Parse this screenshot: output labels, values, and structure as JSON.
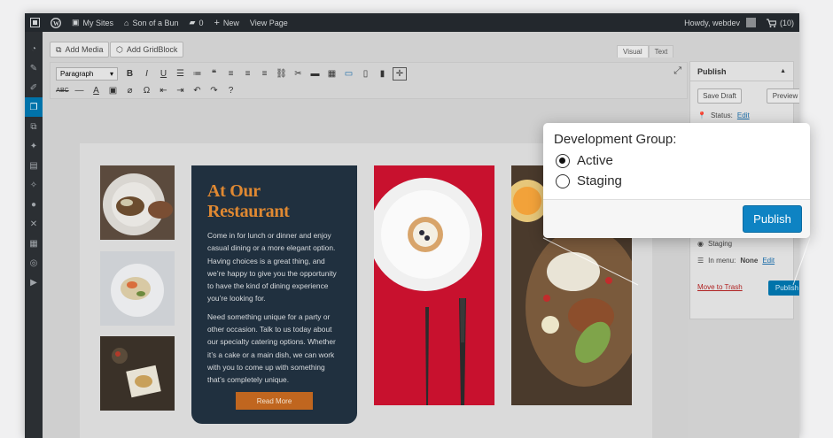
{
  "adminbar": {
    "my_sites": "My Sites",
    "site_name": "Son of a Bun",
    "comments_count": "0",
    "new_label": "New",
    "view_page": "View Page",
    "howdy": "Howdy, webdev",
    "cart": "(10)"
  },
  "editor": {
    "add_media": "Add Media",
    "add_gridblock": "Add GridBlock",
    "tab_visual": "Visual",
    "tab_text": "Text",
    "format_select": "Paragraph"
  },
  "content": {
    "heading": "At Our Restaurant",
    "paragraph1": "Come in for lunch or dinner and enjoy casual dining or a more elegant option. Having choices is a great thing, and we’re happy to give you the opportunity to have the kind of dining experience you’re looking for.",
    "paragraph2": "Need something unique for a party or other occasion. Talk to us today about our specialty catering options. Whether it’s a cake or a main dish, we can work with you to come up with something that’s completely unique.",
    "read_more": "Read More",
    "colors": {
      "card_bg": "#20303f",
      "heading": "#e08932",
      "button": "#c0661f"
    }
  },
  "publish_panel": {
    "title": "Publish",
    "save_draft": "Save Draft",
    "preview": "Preview",
    "status_label": "Status:",
    "status_edit": "Edit",
    "staging": "Staging",
    "in_menu_label": "In menu:",
    "in_menu_value": "None",
    "in_menu_edit": "Edit",
    "move_to_trash": "Move to Trash",
    "publish": "Publish"
  },
  "popup": {
    "title": "Development Group:",
    "options": [
      {
        "label": "Active",
        "checked": true
      },
      {
        "label": "Staging",
        "checked": false
      }
    ],
    "publish_button": "Publish",
    "accent": "#0e83c3"
  },
  "icons": [
    "wordpress-icon",
    "home-icon",
    "comment-icon",
    "plus-icon",
    "cart-icon",
    "dashboard-icon",
    "pages-icon",
    "gridblock-icon",
    "expand-icon",
    "pin-icon",
    "menu-icon",
    "radio-icon"
  ]
}
